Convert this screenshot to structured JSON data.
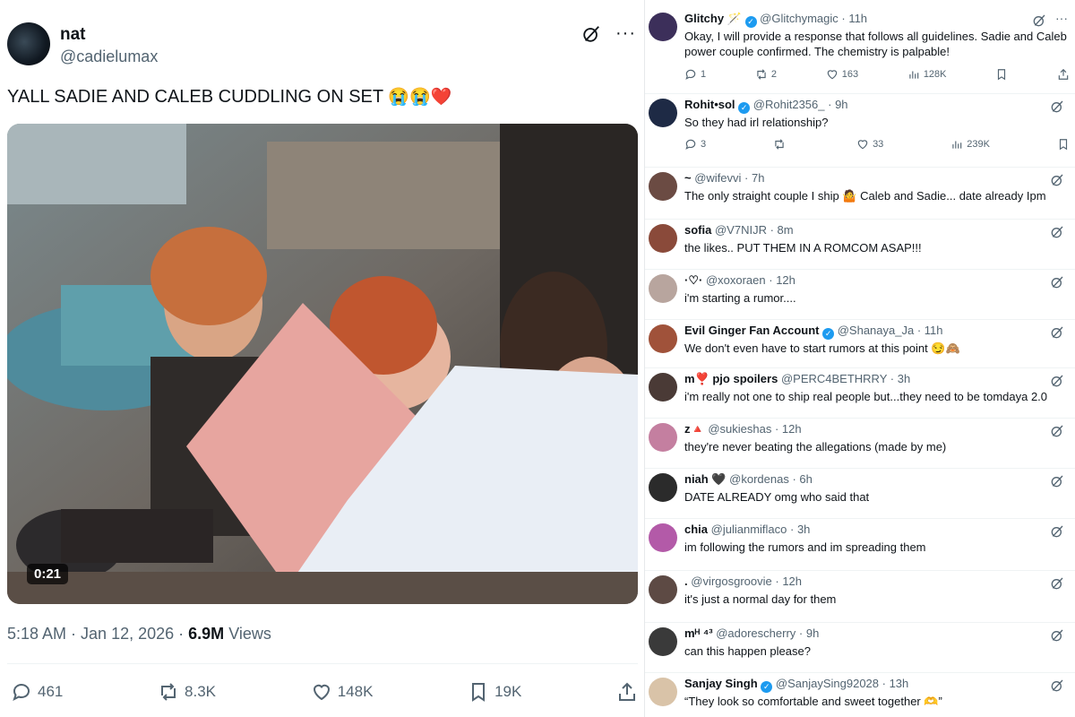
{
  "post": {
    "name": "nat",
    "handle": "@cadielumax",
    "text": "YALL SADIE AND CALEB CUDDLING ON SET",
    "text_emoji": "😭😭❤️",
    "video_duration": "0:21",
    "time": "5:18 AM",
    "date": "Jan 12, 2026",
    "views_count": "6.9M",
    "views_label": "Views",
    "replies": "461",
    "reposts": "8.3K",
    "likes": "148K",
    "bookmarks": "19K",
    "more_glyph": "···"
  },
  "replies": [
    {
      "name": "Glitchy",
      "badges": "🪄",
      "handle": "@Glitchymagic",
      "time": "11h",
      "text": "Okay, I will provide a response that follows all guidelines.  Sadie and Caleb",
      "text2": "power couple confirmed. The chemistry is palpable!",
      "reply_count": "1",
      "repost_count": "2",
      "like_count": "163",
      "view_count": "128K"
    },
    {
      "name": "Rohit•sol",
      "handle": "@Rohit2356_",
      "time": "9h",
      "text": "So they had irl relationship?",
      "reply_count": "3",
      "repost_count": "",
      "like_count": "33",
      "view_count": "239K"
    },
    {
      "name": "~",
      "handle": "@wifevvi",
      "time": "7h",
      "text": "The only straight couple I ship 🤷 Caleb and Sadie... date already Ipm"
    },
    {
      "name": "sofia",
      "handle": "@V7NIJR",
      "time": "8m",
      "text": "the likes.. PUT THEM IN A ROMCOM ASAP!!!"
    },
    {
      "name": "·♡·",
      "handle": "@xoxoraen",
      "time": "12h",
      "text": "i'm starting a rumor...."
    },
    {
      "name": "Evil Ginger Fan Account",
      "handle": "@Shanaya_Ja",
      "time": "11h",
      "text": "We don't even have to start rumors at this point 😏🙈"
    },
    {
      "name": "m❣️ pjo spoilers",
      "handle": "@PERC4BETHRRY",
      "time": "3h",
      "text": "i'm really not one to ship real people but...they need to be tomdaya 2.0"
    },
    {
      "name": "z🔺",
      "handle": "@sukieshas",
      "time": "12h",
      "text": "they're never beating the allegations (made by me)"
    },
    {
      "name": "niah 🖤",
      "handle": "@kordenas",
      "time": "6h",
      "text": "DATE ALREADY omg who said that"
    },
    {
      "name": "chia",
      "handle": "@julianmiflaco",
      "time": "3h",
      "text": "im following the rumors and im spreading them"
    },
    {
      "name": ".",
      "handle": "@virgosgroovie",
      "time": "12h",
      "text": "it's just a normal day for them"
    },
    {
      "name": "mᴴ ⁴³",
      "handle": "@adorescherry",
      "time": "9h",
      "text": "can this happen please?"
    },
    {
      "name": "Sanjay Singh",
      "handle": "@SanjaySing92028",
      "time": "13h",
      "text": "“They look so comfortable and sweet together 🫶”"
    }
  ],
  "colors": {
    "accent": "#1d9bf0",
    "muted": "#536471",
    "text": "#0f1419"
  }
}
